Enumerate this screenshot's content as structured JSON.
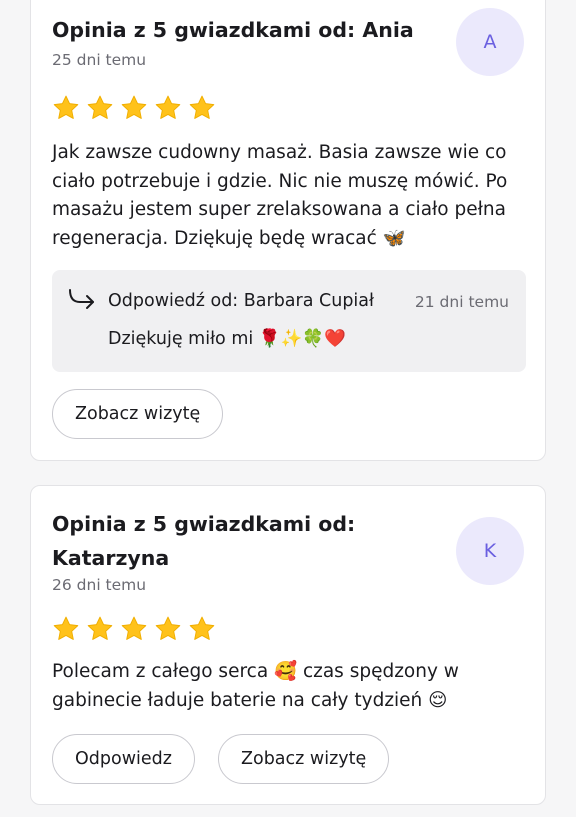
{
  "colors": {
    "page_background": "#f6f6f7",
    "card_background": "#ffffff",
    "star": "#ffc21a",
    "avatar_background": "#ebe9fc",
    "avatar_text": "#6a5fe0",
    "reply_background": "#f0f0f2",
    "muted_text": "#6b6b73"
  },
  "reviews": [
    {
      "title": "Opinia z 5 gwiazdkami od: Ania",
      "date": "25 dni temu",
      "avatar_letter": "A",
      "rating": 5,
      "text": "Jak zawsze cudowny masaż. Basia zawsze wie co ciało potrzebuje i gdzie. Nic nie muszę mówić. Po masażu jestem super zrelaksowana a ciało pełna regeneracja. Dziękuję będę wracać 🦋",
      "reply": {
        "icon": "reply-arrow-icon",
        "author": "Odpowiedź od: Barbara Cupiał",
        "date": "21 dni temu",
        "text": "Dziękuję miło mi 🌹✨🍀❤️"
      },
      "buttons": {
        "view_visit": "Zobacz wizytę"
      }
    },
    {
      "title": "Opinia z 5 gwiazdkami od: Katarzyna",
      "date": "26 dni temu",
      "avatar_letter": "K",
      "rating": 5,
      "text": "Polecam z całego serca 🥰 czas spędzony w gabinecie ładuje baterie na cały tydzień 😌",
      "buttons": {
        "reply": "Odpowiedz",
        "view_visit": "Zobacz wizytę"
      }
    }
  ]
}
